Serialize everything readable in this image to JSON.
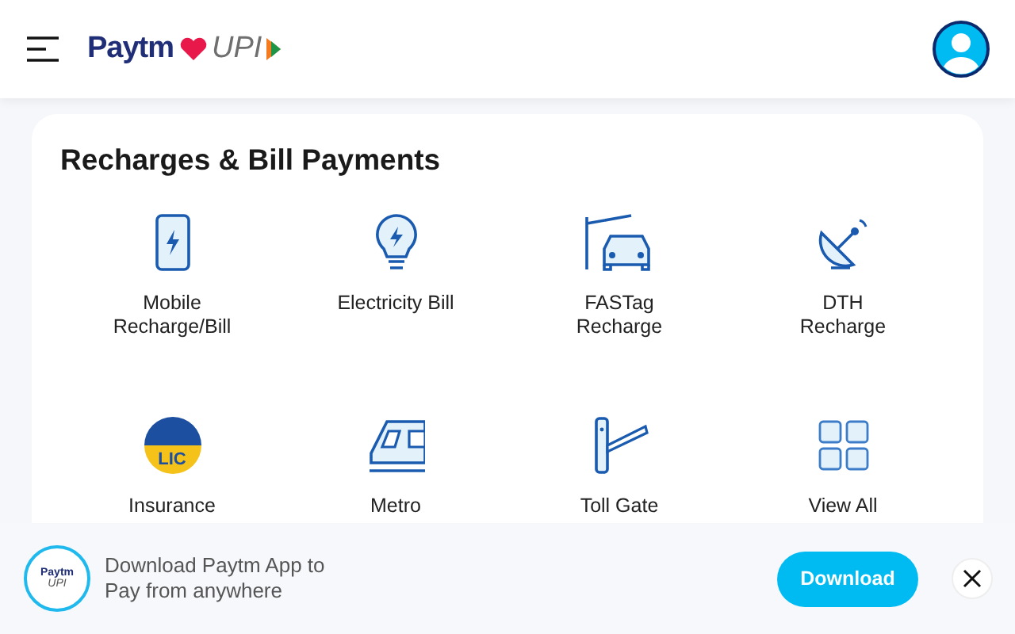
{
  "header": {
    "logo": {
      "brand": "Paytm",
      "upi": "UPI"
    }
  },
  "section": {
    "title": "Recharges & Bill Payments",
    "items": [
      {
        "kind": "phone",
        "label": "Mobile\nRecharge/Bill"
      },
      {
        "kind": "bulb",
        "label": "Electricity Bill"
      },
      {
        "kind": "fastag",
        "label": "FASTag\nRecharge"
      },
      {
        "kind": "dish",
        "label": "DTH\nRecharge"
      },
      {
        "kind": "lic",
        "badge": "LIC",
        "label": "Insurance"
      },
      {
        "kind": "metro",
        "label": "Metro"
      },
      {
        "kind": "toll",
        "label": "Toll Gate"
      },
      {
        "kind": "grid",
        "label": "View All"
      }
    ]
  },
  "banner": {
    "app_icon": {
      "brand": "Paytm",
      "upi": "UPI"
    },
    "message": "Download Paytm App to\nPay from anywhere",
    "button": "Download"
  }
}
